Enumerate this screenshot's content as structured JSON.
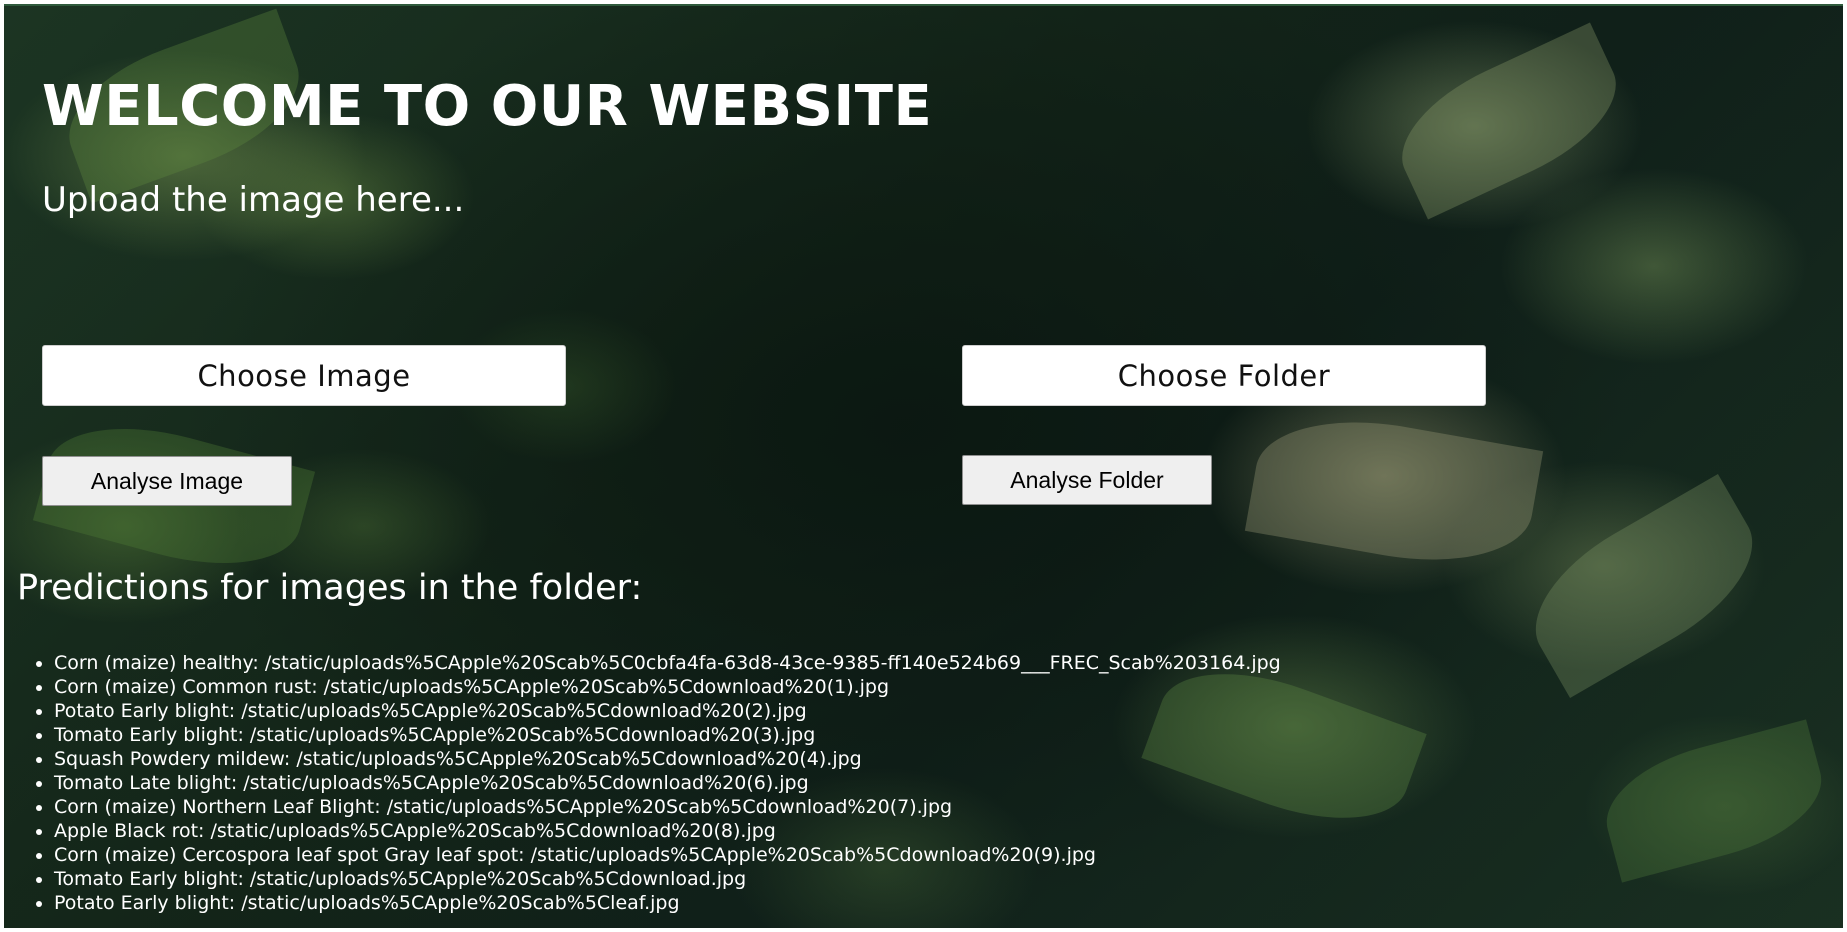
{
  "page": {
    "title": "WELCOME TO OUR WEBSITE",
    "subtitle": "Upload the image here..."
  },
  "upload": {
    "choose_image_label": "Choose Image",
    "choose_folder_label": "Choose Folder",
    "analyse_image_label": "Analyse Image",
    "analyse_folder_label": "Analyse Folder"
  },
  "predictions": {
    "heading": "Predictions for images in the folder:",
    "items": [
      "Corn (maize) healthy: /static/uploads%5CApple%20Scab%5C0cbfa4fa-63d8-43ce-9385-ff140e524b69___FREC_Scab%203164.jpg",
      "Corn (maize) Common rust: /static/uploads%5CApple%20Scab%5Cdownload%20(1).jpg",
      "Potato Early blight: /static/uploads%5CApple%20Scab%5Cdownload%20(2).jpg",
      "Tomato Early blight: /static/uploads%5CApple%20Scab%5Cdownload%20(3).jpg",
      "Squash Powdery mildew: /static/uploads%5CApple%20Scab%5Cdownload%20(4).jpg",
      "Tomato Late blight: /static/uploads%5CApple%20Scab%5Cdownload%20(6).jpg",
      "Corn (maize) Northern Leaf Blight: /static/uploads%5CApple%20Scab%5Cdownload%20(7).jpg",
      "Apple Black rot: /static/uploads%5CApple%20Scab%5Cdownload%20(8).jpg",
      "Corn (maize) Cercospora leaf spot Gray leaf spot: /static/uploads%5CApple%20Scab%5Cdownload%20(9).jpg",
      "Tomato Early blight: /static/uploads%5CApple%20Scab%5Cdownload.jpg",
      "Potato Early blight: /static/uploads%5CApple%20Scab%5Cleaf.jpg"
    ]
  },
  "colors": {
    "text": "#ffffff",
    "background": "#142619",
    "button_primary_bg": "#ffffff",
    "button_secondary_bg": "#efefef"
  }
}
